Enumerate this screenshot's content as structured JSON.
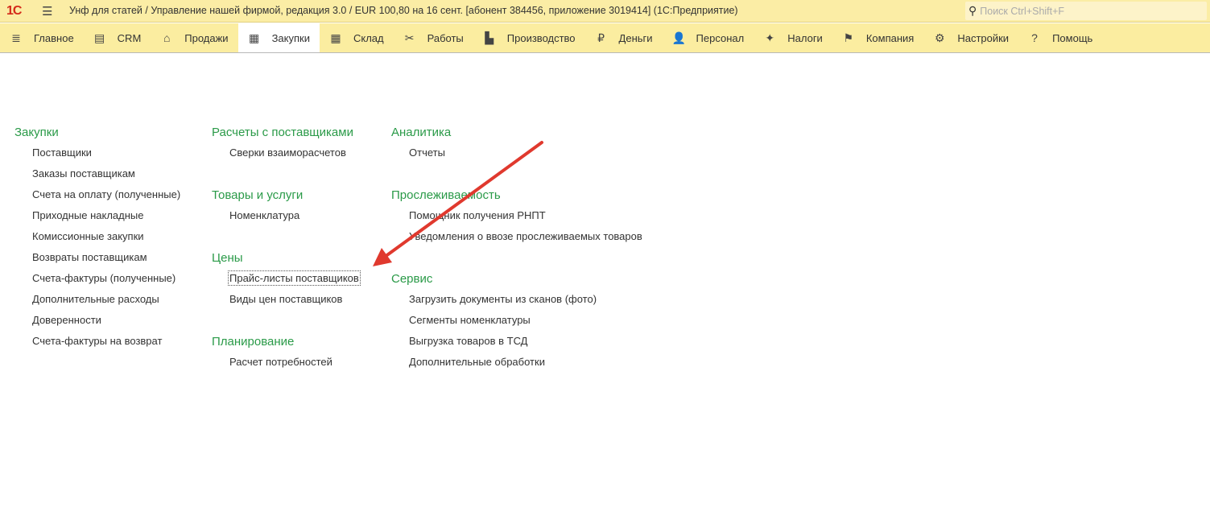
{
  "titlebar": {
    "logo": "1С",
    "title": "Унф для статей / Управление нашей фирмой, редакция 3.0 / EUR 100,80 на 16 сент. [абонент 384456, приложение 3019414]  (1С:Предприятие)",
    "search_placeholder": "Поиск Ctrl+Shift+F"
  },
  "nav": [
    {
      "label": "Главное",
      "icon": "≣"
    },
    {
      "label": "CRM",
      "icon": "▤"
    },
    {
      "label": "Продажи",
      "icon": "⌂"
    },
    {
      "label": "Закупки",
      "icon": "▦"
    },
    {
      "label": "Склад",
      "icon": "▦"
    },
    {
      "label": "Работы",
      "icon": "✂"
    },
    {
      "label": "Производство",
      "icon": "▙"
    },
    {
      "label": "Деньги",
      "icon": "₽"
    },
    {
      "label": "Персонал",
      "icon": "👤"
    },
    {
      "label": "Налоги",
      "icon": "✦"
    },
    {
      "label": "Компания",
      "icon": "⚑"
    },
    {
      "label": "Настройки",
      "icon": "⚙"
    },
    {
      "label": "Помощь",
      "icon": "?"
    }
  ],
  "sections": {
    "purchases": {
      "title": "Закупки",
      "items": [
        "Поставщики",
        "Заказы поставщикам",
        "Счета на оплату (полученные)",
        "Приходные накладные",
        "Комиссионные закупки",
        "Возвраты поставщикам",
        "Счета-фактуры (полученные)",
        "Дополнительные расходы",
        "Доверенности",
        "Счета-фактуры на возврат"
      ]
    },
    "settlements": {
      "title": "Расчеты с поставщиками",
      "items": [
        "Сверки взаиморасчетов"
      ]
    },
    "goods": {
      "title": "Товары и услуги",
      "items": [
        "Номенклатура"
      ]
    },
    "prices": {
      "title": "Цены",
      "items": [
        "Прайс-листы поставщиков",
        "Виды цен поставщиков"
      ]
    },
    "planning": {
      "title": "Планирование",
      "items": [
        "Расчет потребностей"
      ]
    },
    "analytics": {
      "title": "Аналитика",
      "items": [
        "Отчеты"
      ]
    },
    "tracing": {
      "title": "Прослеживаемость",
      "items": [
        "Помощник получения РНПТ",
        "Уведомления о ввозе прослеживаемых товаров"
      ]
    },
    "service": {
      "title": "Сервис",
      "items": [
        "Загрузить документы из сканов (фото)",
        "Сегменты номенклатуры",
        "Выгрузка товаров в ТСД",
        "Дополнительные обработки"
      ]
    }
  },
  "colors": {
    "accent": "#2a9a48",
    "bar": "#fbeda0",
    "arrow": "#e0392e"
  }
}
